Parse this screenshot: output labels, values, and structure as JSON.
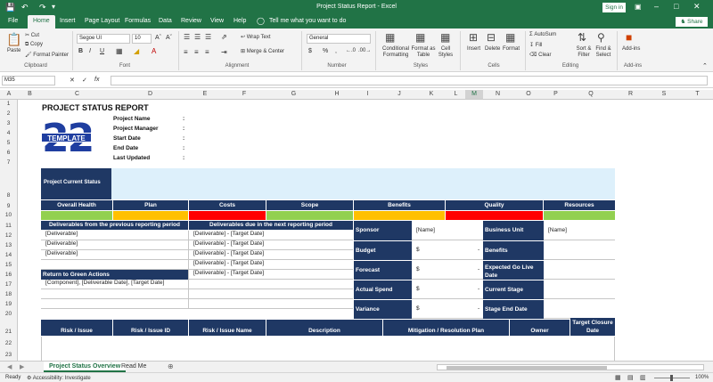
{
  "window": {
    "title": "Project Status Report  -  Excel",
    "sign_in": "Sign in",
    "share": "Share"
  },
  "tabs": [
    "File",
    "Home",
    "Insert",
    "Page Layout",
    "Formulas",
    "Data",
    "Review",
    "View",
    "Help"
  ],
  "tell_me": "Tell me what you want to do",
  "ribbon": {
    "clipboard": {
      "paste": "Paste",
      "cut": "Cut",
      "copy": "Copy",
      "format_painter": "Format Painter",
      "group": "Clipboard"
    },
    "font": {
      "name": "Segoe UI",
      "size": "10",
      "bold": "B",
      "italic": "I",
      "underline": "U",
      "group": "Font"
    },
    "alignment": {
      "wrap": "Wrap Text",
      "merge": "Merge & Center",
      "group": "Alignment"
    },
    "number": {
      "format": "General",
      "currency": "$",
      "percent": "%",
      "comma": ",",
      "group": "Number"
    },
    "styles": {
      "conditional": "Conditional Formatting",
      "format_table": "Format as Table",
      "cell_styles": "Cell Styles",
      "group": "Styles"
    },
    "cells": {
      "insert": "Insert",
      "delete": "Delete",
      "format": "Format",
      "group": "Cells"
    },
    "editing": {
      "autosum": "AutoSum",
      "fill": "Fill",
      "clear": "Clear",
      "sort": "Sort & Filter",
      "find": "Find & Select",
      "group": "Editing"
    },
    "addins": {
      "label": "Add-ins",
      "group": "Add-ins"
    }
  },
  "formula_bar": {
    "name_box": "M35",
    "fx": "fx",
    "value": ""
  },
  "columns": [
    "A",
    "B",
    "C",
    "D",
    "E",
    "F",
    "G",
    "H",
    "I",
    "J",
    "K",
    "L",
    "M",
    "N",
    "O",
    "P",
    "Q",
    "R",
    "S",
    "T"
  ],
  "rows": [
    "1",
    "2",
    "3",
    "4",
    "5",
    "6",
    "7",
    "8",
    "9",
    "10",
    "11",
    "12",
    "13",
    "14",
    "15",
    "16",
    "17",
    "18",
    "19",
    "20",
    "21",
    "22",
    "23"
  ],
  "sheet": {
    "title": "PROJECT STATUS REPORT",
    "logo": {
      "word": "TEMPLATE",
      "number": "22"
    },
    "fields": [
      "Project Name",
      "Project Manager",
      "Start Date",
      "End Date",
      "Last Updated"
    ],
    "colon": ":",
    "current_status": "Project Current Status",
    "health_headers": [
      "Overall Health",
      "Plan",
      "Costs",
      "Scope",
      "Benefits",
      "Quality",
      "Resources"
    ],
    "health_colors": [
      "#92d050",
      "#ffc000",
      "#ff0000",
      "#92d050",
      "#ffc000",
      "#ff0000",
      "#92d050"
    ],
    "prev_header": "Deliverables from the previous reporting period",
    "next_header": "Deliverables due in the next reporting period",
    "prev_items": [
      "[Deliverable]",
      "[Deliverable]",
      "[Deliverable]"
    ],
    "next_items": [
      "[Deliverable] - [Target Date]",
      "[Deliverable] - [Target Date]",
      "[Deliverable] - [Target Date]",
      "[Deliverable] - [Target Date]",
      "[Deliverable] - [Target Date]"
    ],
    "return_header": "Return to Green Actions",
    "return_item": "[Component], [Deliverable Date], [Target Date]",
    "info_left": [
      "Sponsor",
      "Budget",
      "Forecast",
      "Actual Spend",
      "Variance"
    ],
    "info_left_values": [
      "[Name]",
      "$",
      "$",
      "$",
      "$"
    ],
    "dash": "-",
    "info_right": [
      "Business Unit",
      "Benefits",
      "Expected Go Live Date",
      "Current Stage",
      "Stage End Date"
    ],
    "info_right_values": [
      "[Name]",
      "",
      "",
      "",
      ""
    ],
    "risk_headers": [
      "Risk / Issue",
      "Risk / Issue ID",
      "Risk / Issue Name",
      "Description",
      "Mitigation / Resolution Plan",
      "Owner",
      "Target Closure Date"
    ]
  },
  "sheet_tabs": [
    "Project Status Overview",
    "Read Me"
  ],
  "status": {
    "ready": "Ready",
    "accessibility": "Accessibility: Investigate",
    "zoom": "100%"
  }
}
